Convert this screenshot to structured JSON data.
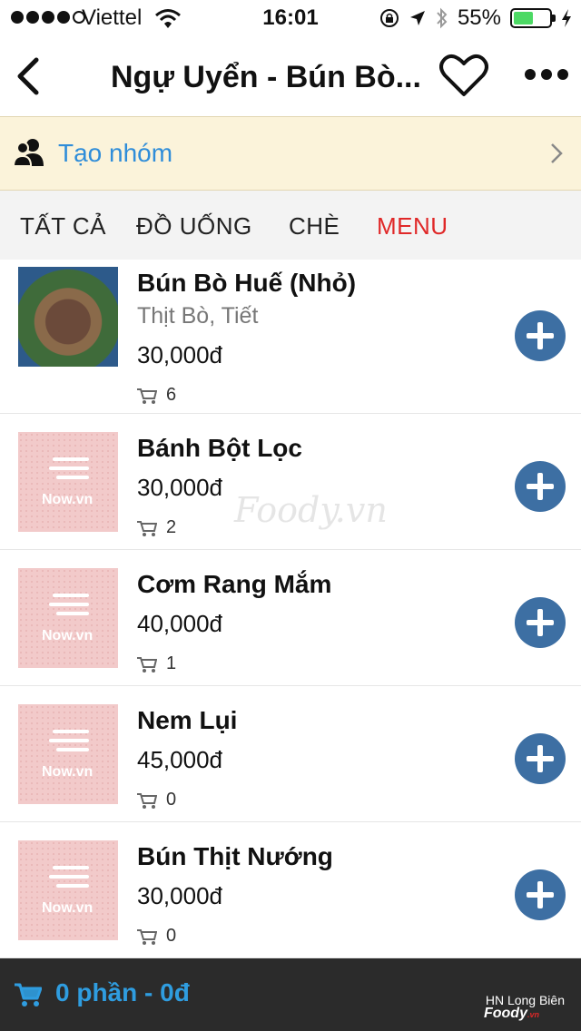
{
  "status_bar": {
    "carrier": "Viettel",
    "time": "16:01",
    "battery": "55%",
    "battery_level": 0.55
  },
  "nav": {
    "title": "Ngự Uyển - Bún Bò..."
  },
  "group": {
    "label": "Tạo nhóm"
  },
  "tabs": [
    {
      "label": "TẤT CẢ",
      "active": false
    },
    {
      "label": "ĐỒ UỐNG",
      "active": false
    },
    {
      "label": "CHÈ",
      "active": false
    },
    {
      "label": "MENU",
      "active": true
    }
  ],
  "items": [
    {
      "name": "Bún Bò Huế (Nhỏ)",
      "desc": "Thịt Bò, Tiết",
      "price": "30,000đ",
      "count": "6",
      "image": "photo"
    },
    {
      "name": "Bánh Bột Lọc",
      "desc": "",
      "price": "30,000đ",
      "count": "2",
      "image": "placeholder"
    },
    {
      "name": "Cơm Rang Mắm",
      "desc": "",
      "price": "40,000đ",
      "count": "1",
      "image": "placeholder"
    },
    {
      "name": "Nem Lụi",
      "desc": "",
      "price": "45,000đ",
      "count": "0",
      "image": "placeholder"
    },
    {
      "name": "Bún Thịt Nướng",
      "desc": "",
      "price": "30,000đ",
      "count": "0",
      "image": "placeholder"
    }
  ],
  "placeholder_logo": "Now.vn",
  "watermark": "Foody.vn",
  "bottom": {
    "cart_summary": "0 phần - 0đ",
    "location": "HN Long Biên",
    "brand": "Foody",
    "brand_suffix": ".vn"
  },
  "colors": {
    "accent_blue": "#2f8dd9",
    "active_tab": "#e02828",
    "add_button": "#3d6fa3",
    "banner": "#fbf3da",
    "bottom_bar": "#2b2b2b"
  }
}
